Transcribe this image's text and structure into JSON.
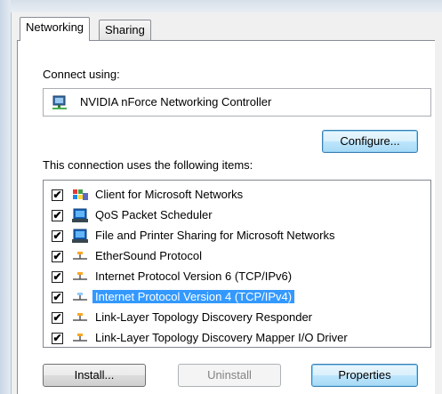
{
  "tabs": [
    {
      "label": "Networking",
      "active": true
    },
    {
      "label": "Sharing",
      "active": false
    }
  ],
  "connect_using_label": "Connect using:",
  "adapter": {
    "name": "NVIDIA nForce Networking Controller",
    "icon": "network-adapter-icon"
  },
  "configure_button": "Configure...",
  "items_heading": "This connection uses the following items:",
  "items": [
    {
      "label": "Client for Microsoft Networks",
      "checked": true,
      "icon": "client-network-icon"
    },
    {
      "label": "QoS Packet Scheduler",
      "checked": true,
      "icon": "service-icon"
    },
    {
      "label": "File and Printer Sharing for Microsoft Networks",
      "checked": true,
      "icon": "service-icon"
    },
    {
      "label": "EtherSound Protocol",
      "checked": true,
      "icon": "protocol-icon"
    },
    {
      "label": "Internet Protocol Version 6 (TCP/IPv6)",
      "checked": true,
      "icon": "protocol-icon"
    },
    {
      "label": "Internet Protocol Version 4 (TCP/IPv4)",
      "checked": true,
      "icon": "protocol-icon",
      "selected": true
    },
    {
      "label": "Link-Layer Topology Discovery Responder",
      "checked": true,
      "icon": "protocol-icon"
    },
    {
      "label": "Link-Layer Topology Discovery Mapper I/O Driver",
      "checked": true,
      "icon": "protocol-icon"
    }
  ],
  "buttons": {
    "install": "Install...",
    "uninstall": "Uninstall",
    "properties": "Properties"
  },
  "colors": {
    "selection": "#3399ff",
    "focus_button": "#bee6fd"
  }
}
